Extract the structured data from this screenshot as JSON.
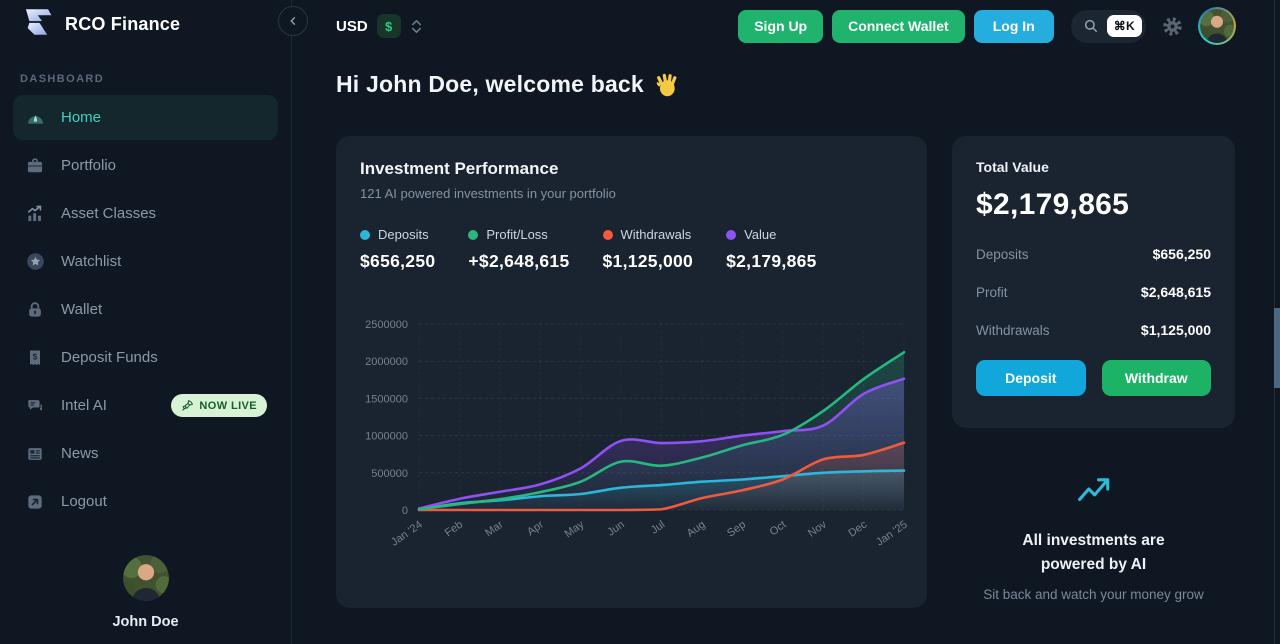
{
  "app": {
    "name": "RCO Finance"
  },
  "topbar": {
    "currency": {
      "code": "USD",
      "symbol": "$"
    },
    "buttons": {
      "sign_up": "Sign Up",
      "connect_wallet": "Connect Wallet",
      "log_in": "Log In"
    },
    "search_shortcut": "⌘K"
  },
  "sidebar": {
    "section_label": "DASHBOARD",
    "items": [
      {
        "label": "Home",
        "icon": "gauge-icon",
        "active": true
      },
      {
        "label": "Portfolio",
        "icon": "briefcase-icon"
      },
      {
        "label": "Asset Classes",
        "icon": "bar-chart-icon"
      },
      {
        "label": "Watchlist",
        "icon": "star-icon"
      },
      {
        "label": "Wallet",
        "icon": "lock-icon"
      },
      {
        "label": "Deposit Funds",
        "icon": "receipt-icon"
      },
      {
        "label": "Intel AI",
        "icon": "chat-icon",
        "badge": "NOW LIVE",
        "badge_icon": "rocket-icon"
      },
      {
        "label": "News",
        "icon": "news-icon"
      },
      {
        "label": "Logout",
        "icon": "logout-icon"
      }
    ],
    "user": {
      "name": "John Doe"
    }
  },
  "main": {
    "greeting": "Hi John Doe, welcome back",
    "card": {
      "title": "Investment Performance",
      "subtitle": "121 AI powered investments in your portfolio",
      "legend": [
        {
          "label": "Deposits",
          "value": "$656,250",
          "color": "#2cb7d8"
        },
        {
          "label": "Profit/Loss",
          "value": "+$2,648,615",
          "color": "#28b781"
        },
        {
          "label": "Withdrawals",
          "value": "$1,125,000",
          "color": "#f05a3d"
        },
        {
          "label": "Value",
          "value": "$2,179,865",
          "color": "#8f52f2"
        }
      ]
    }
  },
  "chart_data": {
    "type": "area",
    "x": [
      "Jan '24",
      "Feb",
      "Mar",
      "Apr",
      "May",
      "Jun",
      "Jul",
      "Aug",
      "Sep",
      "Oct",
      "Nov",
      "Dec",
      "Jan '25"
    ],
    "series": [
      {
        "name": "Deposits",
        "color": "#2cb7d8",
        "values": [
          5000,
          90000,
          130000,
          185000,
          215000,
          300000,
          335000,
          380000,
          410000,
          455000,
          500000,
          520000,
          530000
        ]
      },
      {
        "name": "Profit/Loss",
        "color": "#28b781",
        "values": [
          10000,
          80000,
          145000,
          240000,
          380000,
          650000,
          595000,
          705000,
          870000,
          1010000,
          1330000,
          1760000,
          2120000
        ]
      },
      {
        "name": "Withdrawals",
        "color": "#f05a3d",
        "values": [
          0,
          0,
          0,
          0,
          0,
          0,
          10000,
          160000,
          265000,
          410000,
          680000,
          740000,
          905000
        ]
      },
      {
        "name": "Value",
        "color": "#8f52f2",
        "values": [
          20000,
          150000,
          245000,
          345000,
          560000,
          930000,
          900000,
          925000,
          1000000,
          1060000,
          1135000,
          1560000,
          1765000
        ]
      }
    ],
    "ylim": [
      0,
      2500000
    ],
    "yticks": [
      0,
      500000,
      1000000,
      1500000,
      2000000,
      2500000
    ],
    "grid": "dashed",
    "legend_position": "top",
    "draw_order": [
      "Value",
      "Deposits",
      "Withdrawals",
      "Profit/Loss"
    ]
  },
  "summary": {
    "title": "Total Value",
    "total": "$2,179,865",
    "rows": [
      {
        "label": "Deposits",
        "value": "$656,250"
      },
      {
        "label": "Profit",
        "value": "$2,648,615"
      },
      {
        "label": "Withdrawals",
        "value": "$1,125,000"
      }
    ],
    "buttons": {
      "deposit": "Deposit",
      "withdraw": "Withdraw"
    }
  },
  "promo": {
    "title": "All investments are powered by AI",
    "subtitle": "Sit back and watch your money grow"
  }
}
